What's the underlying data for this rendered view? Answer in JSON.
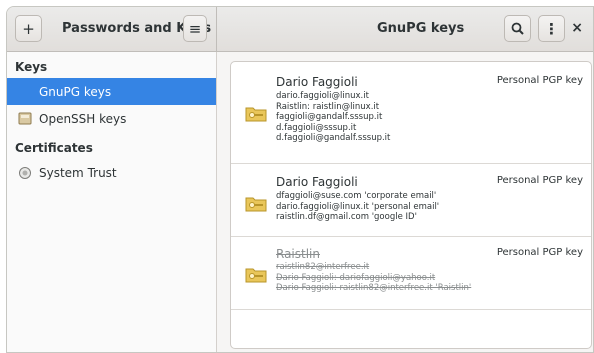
{
  "header": {
    "add_label": "+",
    "app_title": "Passwords and Keys",
    "menu_label": "≡",
    "view_title": "GnuPG keys",
    "search_label": "🔍",
    "more_label": "⋮",
    "close_label": "×"
  },
  "sidebar": {
    "keys_heading": "Keys",
    "certificates_heading": "Certificates",
    "items": [
      {
        "label": "GnuPG keys",
        "icon": "gnupg-key-icon"
      },
      {
        "label": "OpenSSH keys",
        "icon": "openssh-key-icon"
      },
      {
        "label": "System Trust",
        "icon": "certificate-icon"
      }
    ]
  },
  "keys": [
    {
      "name": "Dario Faggioli",
      "type": "Personal PGP key",
      "details": [
        "dario.faggioli@linux.it",
        "Raistlin: raistlin@linux.it",
        "faggioli@gandalf.sssup.it",
        "d.faggioli@sssup.it",
        "d.faggioli@gandalf.sssup.it"
      ]
    },
    {
      "name": "Dario Faggioli",
      "type": "Personal PGP key",
      "details": [
        "dfaggioli@suse.com 'corporate email'",
        "dario.faggioli@linux.it 'personal email'",
        "raistlin.df@gmail.com 'google ID'"
      ]
    },
    {
      "name": "Raistlin",
      "type": "Personal PGP key",
      "details": [
        "raistlin82@interfree.it",
        "Dario Faggioli: dariofaggioli@yahoo.it",
        "Dario Faggioli: raistlin82@interfree.it 'Raistlin'"
      ]
    }
  ],
  "colors": {
    "accent": "#3584e4",
    "key_icon": "#e9c65a"
  }
}
